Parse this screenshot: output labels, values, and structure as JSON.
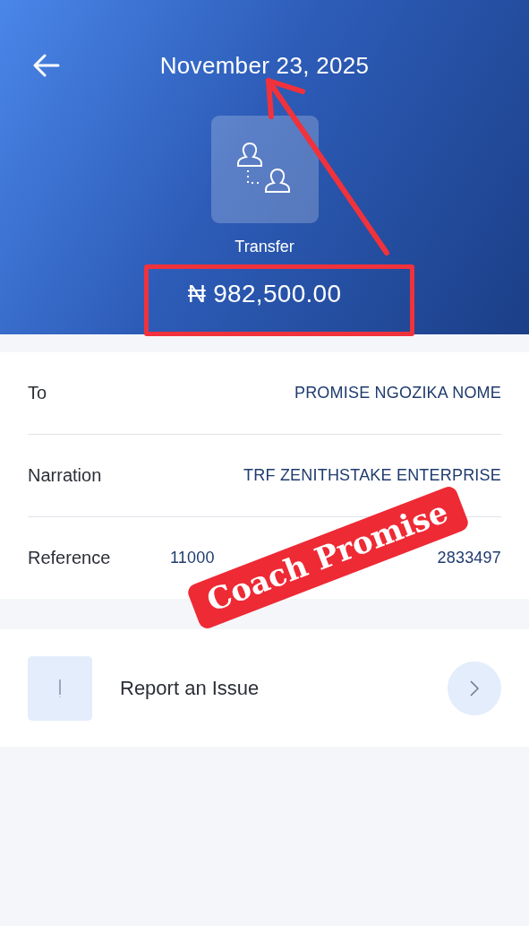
{
  "header": {
    "title": "November 23, 2025",
    "type_label": "Transfer",
    "amount": "₦ 982,500.00"
  },
  "details": [
    {
      "kind": "text",
      "label": "To",
      "value": "PROMISE NGOZIKA NOME"
    },
    {
      "kind": "text",
      "label": "Narration",
      "value": "TRF ZENITHSTAKE ENTERPRISE"
    },
    {
      "kind": "split",
      "label": "Reference",
      "value_parts": [
        "11000",
        "2833497"
      ]
    }
  ],
  "actions": [
    {
      "label": "Report an Issue"
    }
  ],
  "annotations": {
    "sticker": "Coach Promise"
  }
}
